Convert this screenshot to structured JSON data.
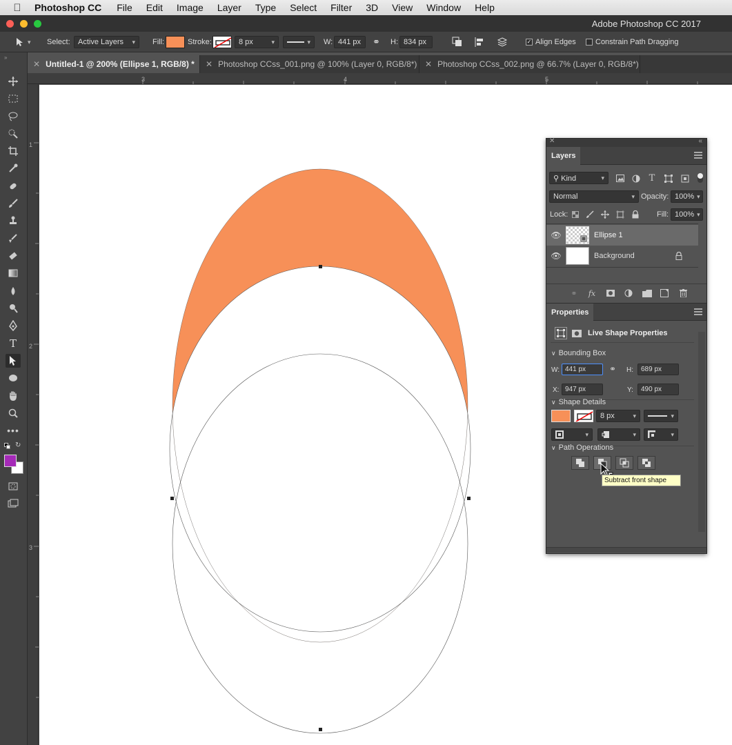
{
  "menubar": {
    "app": "Photoshop CC",
    "items": [
      "File",
      "Edit",
      "Image",
      "Layer",
      "Type",
      "Select",
      "Filter",
      "3D",
      "View",
      "Window",
      "Help"
    ]
  },
  "window": {
    "title": "Adobe Photoshop CC 2017"
  },
  "options": {
    "select_label": "Select:",
    "select_value": "Active Layers",
    "fill_label": "Fill:",
    "fill_color": "#f79058",
    "stroke_label": "Stroke:",
    "stroke_size": "8 px",
    "w_label": "W:",
    "w_value": "441 px",
    "h_label": "H:",
    "h_value": "834 px",
    "align_edges": "Align Edges",
    "constrain": "Constrain Path Dragging"
  },
  "tabs": [
    {
      "label": "Untitled-1 @ 200% (Ellipse 1, RGB/8) *",
      "active": true
    },
    {
      "label": "Photoshop CCss_001.png @ 100% (Layer 0, RGB/8*)",
      "active": false
    },
    {
      "label": "Photoshop CCss_002.png @ 66.7% (Layer 0, RGB/8*)",
      "active": false
    }
  ],
  "rulers": {
    "top": [
      "3",
      "4",
      "5"
    ],
    "left": [
      "1",
      "2",
      "3"
    ]
  },
  "colors": {
    "foreground": "#a52ab8",
    "background": "#ffffff",
    "shape_fill": "#f79058"
  },
  "layers_panel": {
    "title": "Layers",
    "filter": "Kind",
    "blend_mode": "Normal",
    "opacity_label": "Opacity:",
    "opacity": "100%",
    "lock_label": "Lock:",
    "fill_label": "Fill:",
    "fill": "100%",
    "layers": [
      {
        "name": "Ellipse 1",
        "selected": true
      },
      {
        "name": "Background",
        "selected": false
      }
    ]
  },
  "properties_panel": {
    "title": "Properties",
    "subtitle": "Live Shape Properties",
    "bounding_box": "Bounding Box",
    "w_label": "W:",
    "w_value": "441 px",
    "h_label": "H:",
    "h_value": "689 px",
    "x_label": "X:",
    "x_value": "947 px",
    "y_label": "Y:",
    "y_value": "490 px",
    "shape_details": "Shape Details",
    "stroke_size": "8 px",
    "path_operations": "Path Operations",
    "tooltip": "Subtract front shape"
  }
}
